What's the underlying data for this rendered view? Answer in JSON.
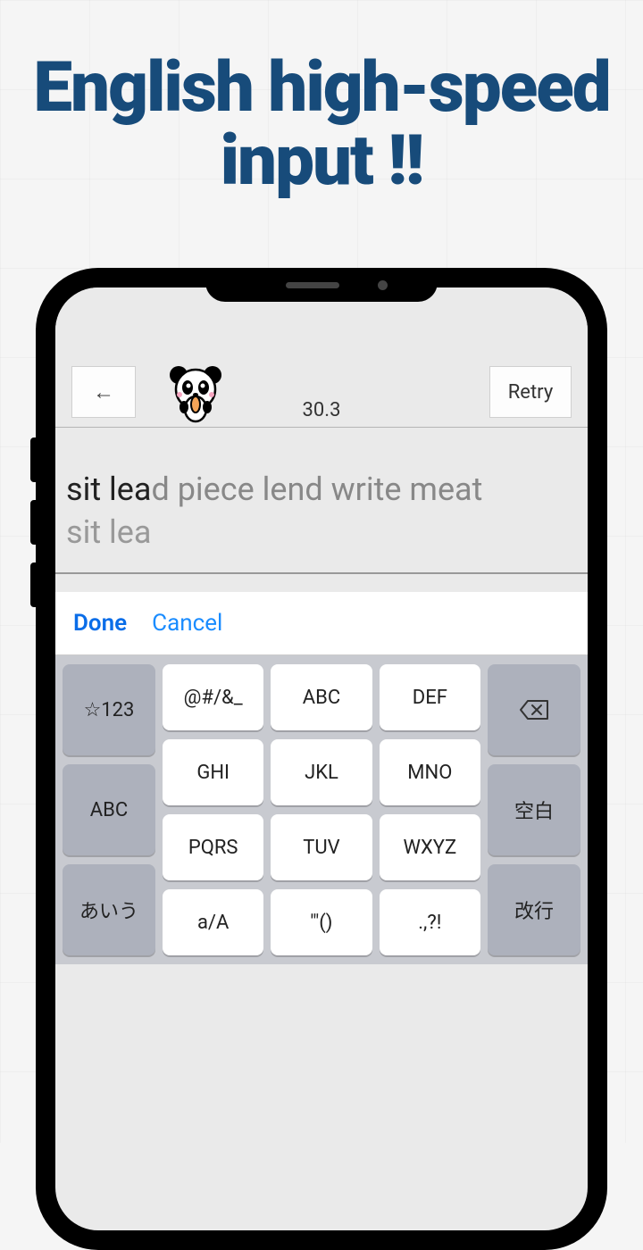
{
  "headline": "English high-speed input !!",
  "top_bar": {
    "back_arrow": "←",
    "retry_label": "Retry",
    "timer": "30.3"
  },
  "text_area": {
    "target_prefix": "sit lea",
    "target_suffix": "d piece lend write meat",
    "typed": "sit lea"
  },
  "suggest": {
    "done": "Done",
    "cancel": "Cancel"
  },
  "keyboard": {
    "row1_side_left": "☆123",
    "row1_key1": "@#/&_",
    "row1_key2": "ABC",
    "row1_key3": "DEF",
    "row2_side_left": "ABC",
    "row2_key1": "GHI",
    "row2_key2": "JKL",
    "row2_key3": "MNO",
    "row2_side_right": "空白",
    "row3_side_left": "あいう",
    "row3_key1": "PQRS",
    "row3_key2": "TUV",
    "row3_key3": "WXYZ",
    "row3_side_right": "改行",
    "row4_key1": "a/A",
    "row4_key2": "'\"()",
    "row4_key3": ".,?!"
  }
}
